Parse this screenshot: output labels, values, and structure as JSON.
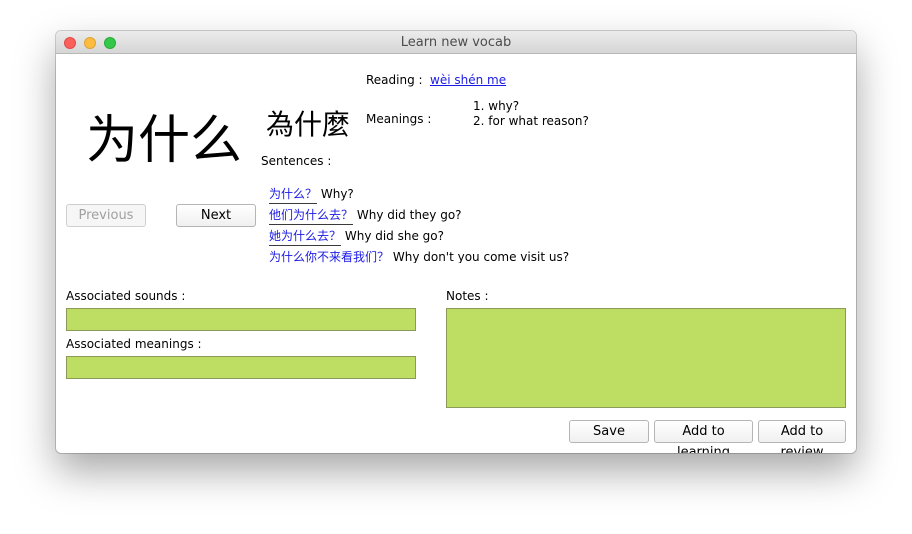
{
  "window": {
    "title": "Learn new vocab"
  },
  "word": {
    "simplified": "为什么",
    "traditional": "為什麼",
    "reading_label": "Reading :",
    "reading": "wèi shén me",
    "meanings_label": "Meanings :",
    "meanings": [
      "1. why?",
      "2. for what reason?"
    ],
    "sentences_label": "Sentences :",
    "sentences": [
      {
        "cn": "为什么？",
        "en": "Why?"
      },
      {
        "cn": "他们为什么去？",
        "en": "Why did they go?"
      },
      {
        "cn": "她为什么去？",
        "en": "Why did she go?"
      },
      {
        "cn": "为什么你不来看我们？",
        "en": "Why don't you come visit us?"
      }
    ]
  },
  "nav": {
    "previous_label": "Previous",
    "next_label": "Next"
  },
  "form": {
    "sounds_label": "Associated sounds :",
    "sounds_value": "",
    "meanings_label": "Associated meanings :",
    "meanings_value": "",
    "notes_label": "Notes :",
    "notes_value": ""
  },
  "actions": {
    "save_label": "Save",
    "add_learning_label": "Add to learning",
    "add_review_label": "Add to review"
  },
  "colors": {
    "field_fill": "#bede63",
    "link": "#1a1ae6",
    "close": "#fc605c",
    "minimize": "#fdbc40",
    "maximize": "#34c84a"
  }
}
